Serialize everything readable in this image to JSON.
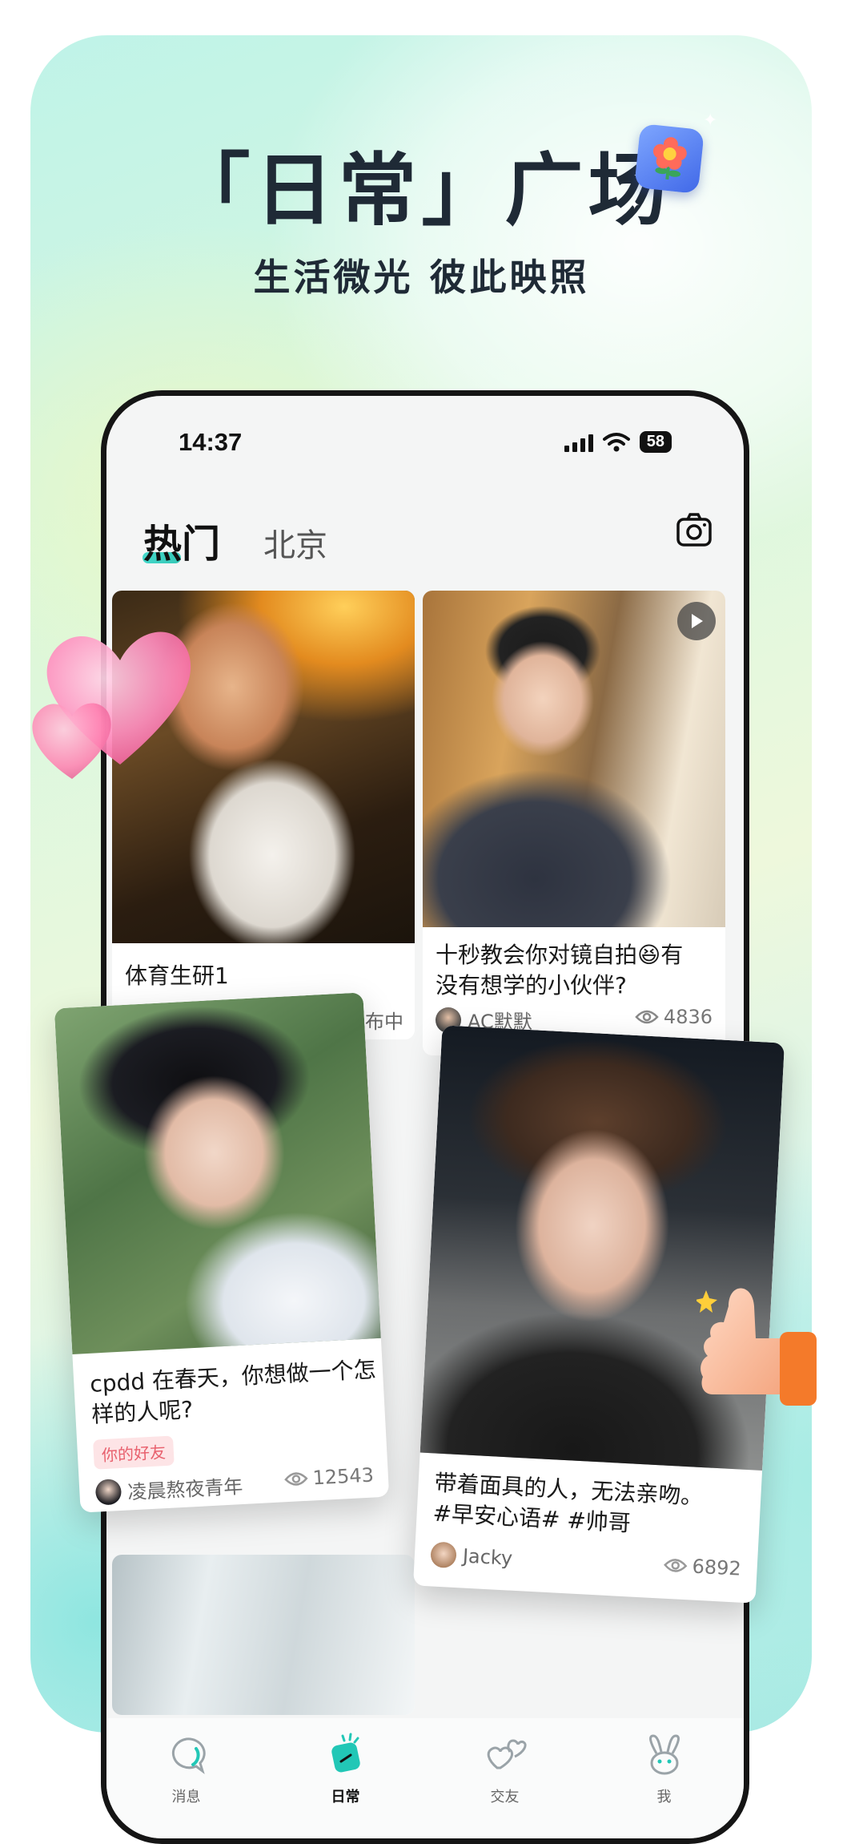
{
  "promo": {
    "headline": "「日常」广场",
    "subline": "生活微光  彼此映照"
  },
  "status_bar": {
    "time": "14:37",
    "battery": "58"
  },
  "header": {
    "tabs": [
      {
        "label": "热门",
        "active": true
      },
      {
        "label": "北京",
        "active": false
      }
    ]
  },
  "feed": {
    "posts": [
      {
        "title": "体育生研1",
        "author_partial": "布中"
      },
      {
        "title_line1": "十秒教会你对镜自拍😆有",
        "title_line2": "没有想学的小伙伴?",
        "author": "AC默默",
        "views": "4836",
        "has_video": true
      },
      {
        "title_line1": "cpdd 在春天，你想做一个怎",
        "title_line2": "样的人呢?",
        "tag": "你的好友",
        "author": "凌晨熬夜青年",
        "views": "12543"
      },
      {
        "title_line1": "带着面具的人，无法亲吻。",
        "title_line2": "#早安心语# #帅哥",
        "author": "Jacky",
        "views": "6892"
      }
    ]
  },
  "bottom_nav": {
    "items": [
      {
        "label": "消息",
        "icon": "chat-bubble-icon",
        "active": false
      },
      {
        "label": "日常",
        "icon": "daily-card-icon",
        "active": true
      },
      {
        "label": "交友",
        "icon": "hearts-icon",
        "active": false
      },
      {
        "label": "我",
        "icon": "bunny-icon",
        "active": false
      }
    ]
  },
  "colors": {
    "accent": "#22c7b6",
    "tag_bg": "#fde4e6",
    "tag_text": "#e8606d",
    "text_dark": "#1f2a36"
  }
}
